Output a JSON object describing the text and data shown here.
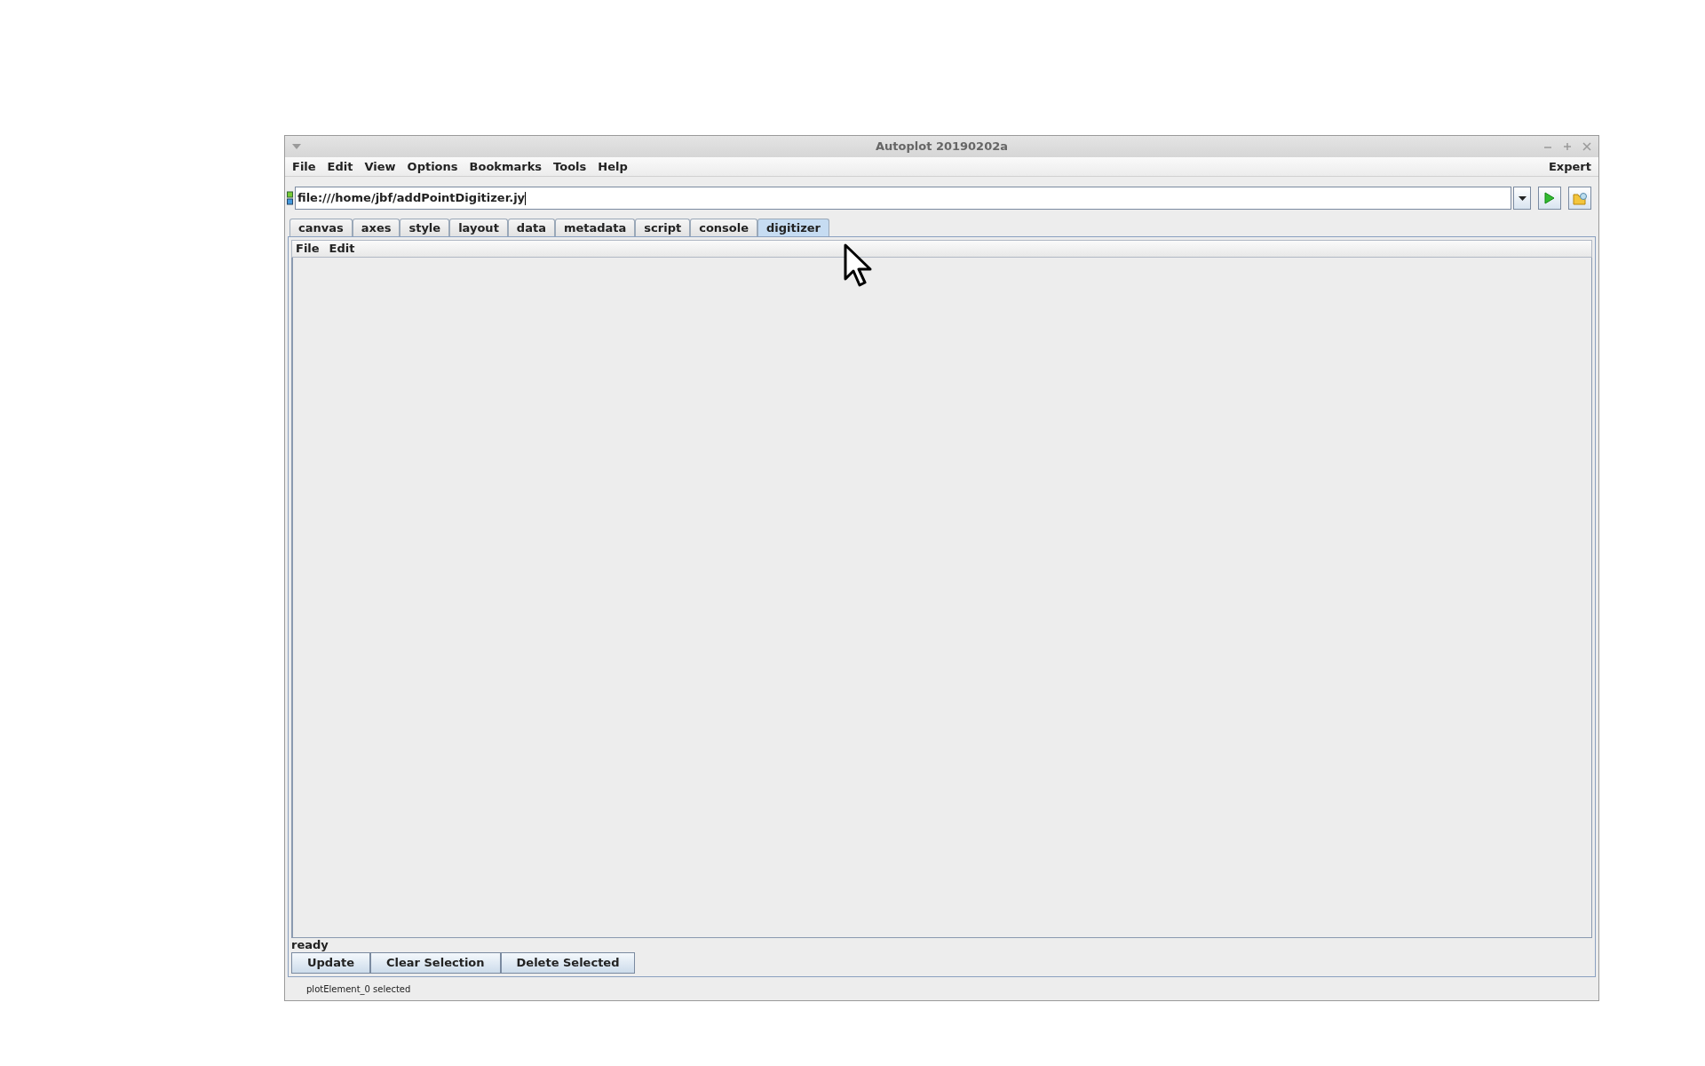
{
  "window": {
    "title": "Autoplot 20190202a"
  },
  "menu": [
    "File",
    "Edit",
    "View",
    "Options",
    "Bookmarks",
    "Tools",
    "Help"
  ],
  "menu_right": "Expert",
  "address": {
    "value": "file:///home/jbf/addPointDigitizer.jy"
  },
  "tabs": [
    {
      "label": "canvas",
      "selected": false
    },
    {
      "label": "axes",
      "selected": false
    },
    {
      "label": "style",
      "selected": false
    },
    {
      "label": "layout",
      "selected": false
    },
    {
      "label": "data",
      "selected": false
    },
    {
      "label": "metadata",
      "selected": false
    },
    {
      "label": "script",
      "selected": false
    },
    {
      "label": "console",
      "selected": false
    },
    {
      "label": "digitizer",
      "selected": true
    }
  ],
  "panel": {
    "menu": [
      "File",
      "Edit"
    ],
    "status": "ready",
    "buttons": [
      "Update",
      "Clear Selection",
      "Delete Selected"
    ]
  },
  "status_bar": "plotElement_0 selected"
}
